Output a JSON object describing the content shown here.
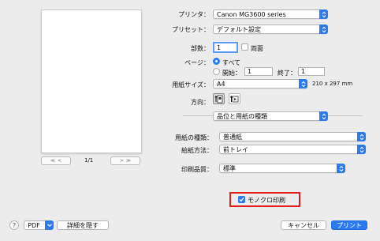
{
  "preview": {
    "page_counter": "1/1",
    "nav_first": "≪",
    "nav_prev": "<",
    "nav_next": ">",
    "nav_last": "≫"
  },
  "printer": {
    "label": "プリンタ：",
    "value": "Canon MG3600 series"
  },
  "preset": {
    "label": "プリセット：",
    "value": "デフォルト設定"
  },
  "copies": {
    "label": "部数：",
    "value": "1",
    "duplex_label": "両面"
  },
  "pages": {
    "label": "ページ：",
    "all_label": "すべて",
    "from_label": "開始：",
    "from_value": "1",
    "to_label": "終了：",
    "to_value": "1"
  },
  "paper_size": {
    "label": "用紙サイズ：",
    "value": "A4",
    "dimensions": "210 x 297 mm"
  },
  "orientation": {
    "label": "方向："
  },
  "section": {
    "value": "品位と用紙の種類"
  },
  "media_type": {
    "label": "用紙の種類：",
    "value": "普通紙"
  },
  "paper_source": {
    "label": "給紙方法：",
    "value": "前トレイ"
  },
  "print_quality": {
    "label": "印刷品質：",
    "value": "標準"
  },
  "grayscale": {
    "label": "モノクロ印刷",
    "checked": true
  },
  "footer": {
    "help": "?",
    "pdf_label": "PDF",
    "hide_details_label": "詳細を隠す",
    "cancel_label": "キャンセル",
    "print_label": "プリント"
  },
  "colors": {
    "accent": "#2b7bef",
    "highlight": "#e21b1b"
  }
}
